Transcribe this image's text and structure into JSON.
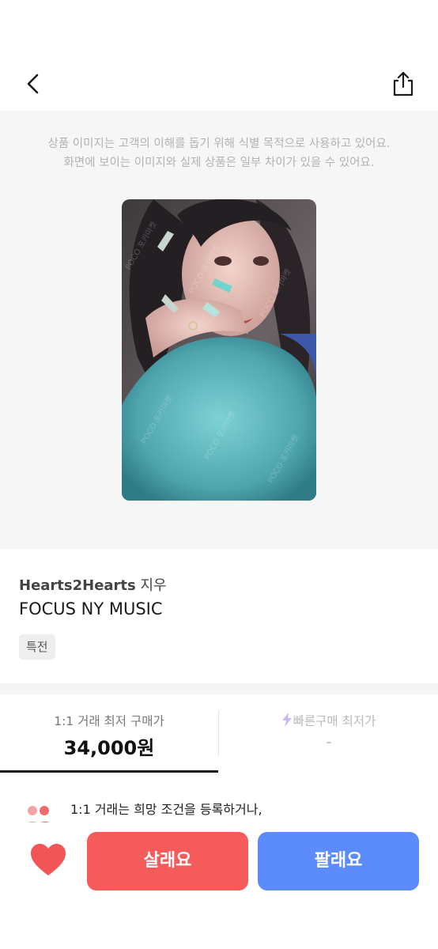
{
  "header": {
    "back_icon": "chevron-left-icon",
    "share_icon": "share-icon"
  },
  "image_notice": {
    "line1": "상품 이미지는 고객의 이해를 돕기 위해 식별 목적으로 사용하고 있어요.",
    "line2": "화면에 보이는 이미지와 실제 상품은 일부 차이가 있을 수 있어요."
  },
  "product": {
    "group": "Hearts2Hearts",
    "member": "지우",
    "title": "FOCUS NY MUSIC",
    "tag": "특전"
  },
  "price_tabs": {
    "left": {
      "label": "1:1 거래 최저 구매가",
      "value": "34,000원"
    },
    "right": {
      "label": "빠른구매 최저가",
      "value": "-",
      "icon": "lightning-icon"
    }
  },
  "trade_notice": {
    "line1": "1:1 거래는 희망 조건을 등록하거나,",
    "icon": "people-icon"
  },
  "actions": {
    "like_icon": "heart-icon",
    "buy_label": "살래요",
    "sell_label": "팔래요"
  },
  "colors": {
    "buy": "#f65b5b",
    "sell": "#5c8cfb",
    "heart": "#f25555",
    "bolt": "#c8b6f7"
  }
}
